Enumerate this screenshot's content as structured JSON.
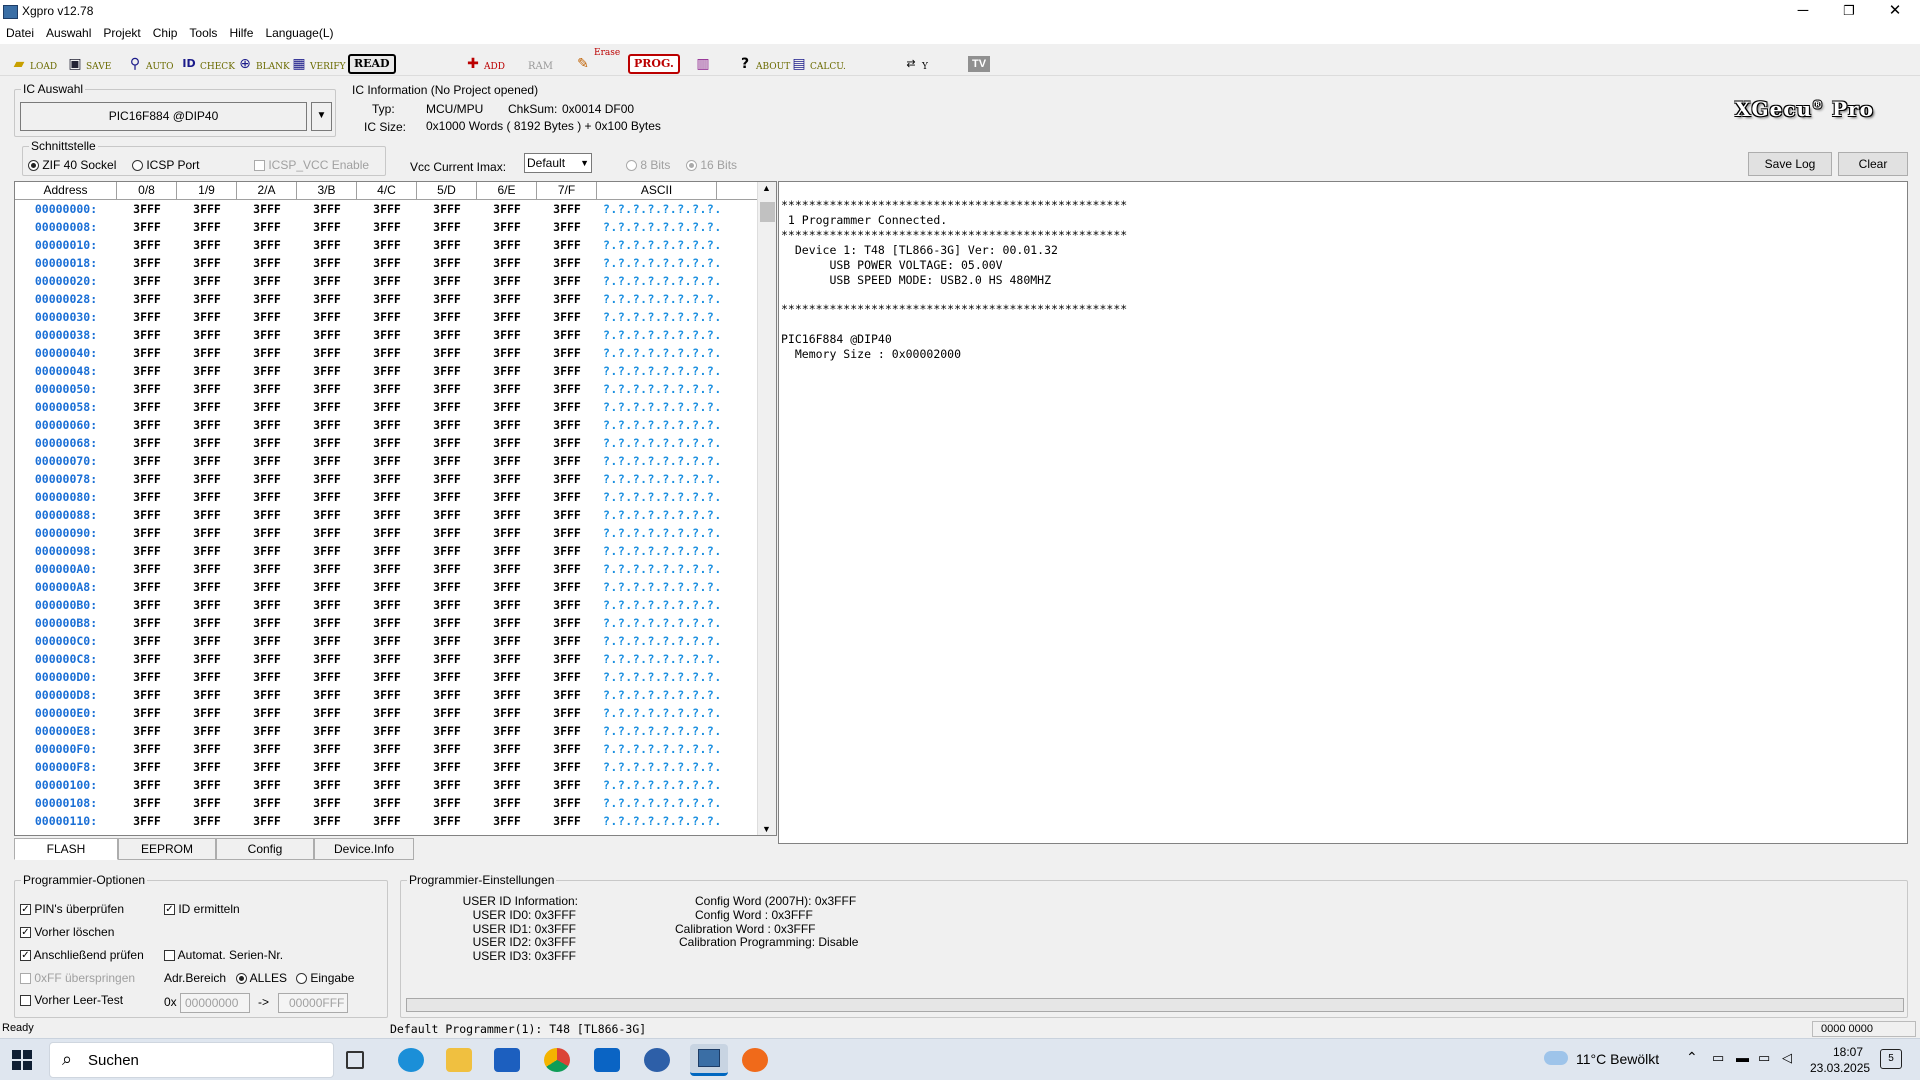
{
  "window": {
    "title": "Xgpro v12.78",
    "min": "─",
    "max": "❐",
    "close": "✕"
  },
  "menu": [
    "Datei",
    "Auswahl",
    "Projekt",
    "Chip",
    "Tools",
    "Hilfe",
    "Language(L)"
  ],
  "toolbar": {
    "load": "LOAD",
    "save": "SAVE",
    "auto": "AUTO",
    "check": "CHECK",
    "blank": "BLANK",
    "verify": "VERIFY",
    "read": "READ",
    "add": "ADD",
    "ram": "RAM",
    "erase": "Erase",
    "prog": "PROG.",
    "about": "ABOUT",
    "calcu": "CALCU.",
    "tv": "TV",
    "swap": "Y"
  },
  "ic": {
    "group": "IC Auswahl",
    "selected": "PIC16F884 @DIP40"
  },
  "info": {
    "group": "IC Information (No Project opened)",
    "typ_label": "Typ:",
    "typ": "MCU/MPU",
    "chksum_label": "ChkSum:",
    "chksum": "0x0014 DF00",
    "size_label": "IC Size:",
    "size": "0x1000 Words ( 8192 Bytes ) + 0x100 Bytes"
  },
  "logo": {
    "text": "XGecu",
    "sup": "®",
    "suffix": "Pro"
  },
  "interface": {
    "group": "Schnittstelle",
    "zif": "ZIF 40 Sockel",
    "icsp": "ICSP Port",
    "icsp_vcc": "ICSP_VCC Enable"
  },
  "vcc": {
    "label": "Vcc Current Imax:",
    "value": "Default",
    "bits8": "8 Bits",
    "bits16": "16 Bits"
  },
  "log_buttons": {
    "save": "Save Log",
    "clear": "Clear"
  },
  "hex": {
    "headers": [
      "Address",
      "0/8",
      "1/9",
      "2/A",
      "3/B",
      "4/C",
      "5/D",
      "6/E",
      "7/F",
      "ASCII"
    ],
    "addresses": [
      "00000000:",
      "00000008:",
      "00000010:",
      "00000018:",
      "00000020:",
      "00000028:",
      "00000030:",
      "00000038:",
      "00000040:",
      "00000048:",
      "00000050:",
      "00000058:",
      "00000060:",
      "00000068:",
      "00000070:",
      "00000078:",
      "00000080:",
      "00000088:",
      "00000090:",
      "00000098:",
      "000000A0:",
      "000000A8:",
      "000000B0:",
      "000000B8:",
      "000000C0:",
      "000000C8:",
      "000000D0:",
      "000000D8:",
      "000000E0:",
      "000000E8:",
      "000000F0:",
      "000000F8:",
      "00000100:",
      "00000108:",
      "00000110:"
    ],
    "word": "3FFF",
    "ascii": "?.?.?.?.?.?.?.?."
  },
  "tabs": [
    "FLASH",
    "EEPROM",
    "Config",
    "Device.Info"
  ],
  "log": [
    "**************************************************",
    " 1 Programmer Connected.",
    "**************************************************",
    "  Device 1: T48 [TL866-3G] Ver: 00.01.32",
    "       USB POWER VOLTAGE: 05.00V",
    "       USB SPEED MODE: USB2.0 HS 480MHZ",
    "",
    "**************************************************",
    "",
    "PIC16F884 @DIP40",
    "  Memory Size : 0x00002000"
  ],
  "options": {
    "group": "Programmier-Optionen",
    "pins": "PIN's überprüfen",
    "id": "ID ermitteln",
    "erase": "Vorher löschen",
    "verify": "Anschließend prüfen",
    "serial": "Automat. Serien-Nr.",
    "skipff": "0xFF überspringen",
    "addr_label": "Adr.Bereich",
    "alles": "ALLES",
    "eingabe": "Eingabe",
    "blank": "Vorher Leer-Test",
    "hex_prefix": "0x",
    "from": "00000000",
    "arrow": "->",
    "to": "00000FFF"
  },
  "settings": {
    "group": "Programmier-Einstellungen",
    "left": [
      "USER ID Information:",
      "USER ID0: 0x3FFF",
      "USER ID1: 0x3FFF",
      "USER ID2: 0x3FFF",
      "USER ID3: 0x3FFF"
    ],
    "right": [
      "Config Word (2007H): 0x3FFF",
      "Config Word : 0x3FFF",
      "Calibration Word : 0x3FFF",
      "Calibration Programming: Disable"
    ]
  },
  "status": {
    "ready": "Ready",
    "programmer": "Default Programmer(1): T48 [TL866-3G]",
    "counter": "0000 0000"
  },
  "taskbar": {
    "search": "Suchen",
    "weather": "11°C  Bewölkt",
    "time": "18:07",
    "date": "23.03.2025",
    "notif": "5"
  }
}
